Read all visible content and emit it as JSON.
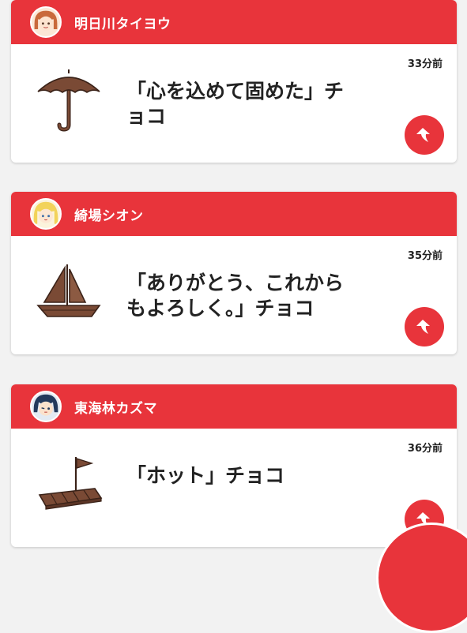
{
  "messages": [
    {
      "sender": "明日川タイヨウ",
      "avatar_icon": "character-avatar-taiyou-icon",
      "time": "33分前",
      "line1": "「心を込めて固めた」チ",
      "line2": "ョコ",
      "choco_icon": "umbrella-chocolate-icon",
      "reply_icon": "reply-arrow-icon"
    },
    {
      "sender": "綺場シオン",
      "avatar_icon": "character-avatar-shion-icon",
      "time": "35分前",
      "line1": "「ありがとう、これから",
      "line2": "もよろしく。」チョコ",
      "choco_icon": "sailboat-chocolate-icon",
      "reply_icon": "reply-arrow-icon"
    },
    {
      "sender": "東海林カズマ",
      "avatar_icon": "character-avatar-kazuma-icon",
      "time": "36分前",
      "line1": "「ホット」チョコ",
      "line2": "",
      "choco_icon": "raft-flag-chocolate-icon",
      "reply_icon": "reply-arrow-icon"
    }
  ],
  "colors": {
    "accent": "#e8343b",
    "chocolate": "#7a4a35",
    "background": "#f2f2f2"
  },
  "floating_button_icon": "fab-button"
}
